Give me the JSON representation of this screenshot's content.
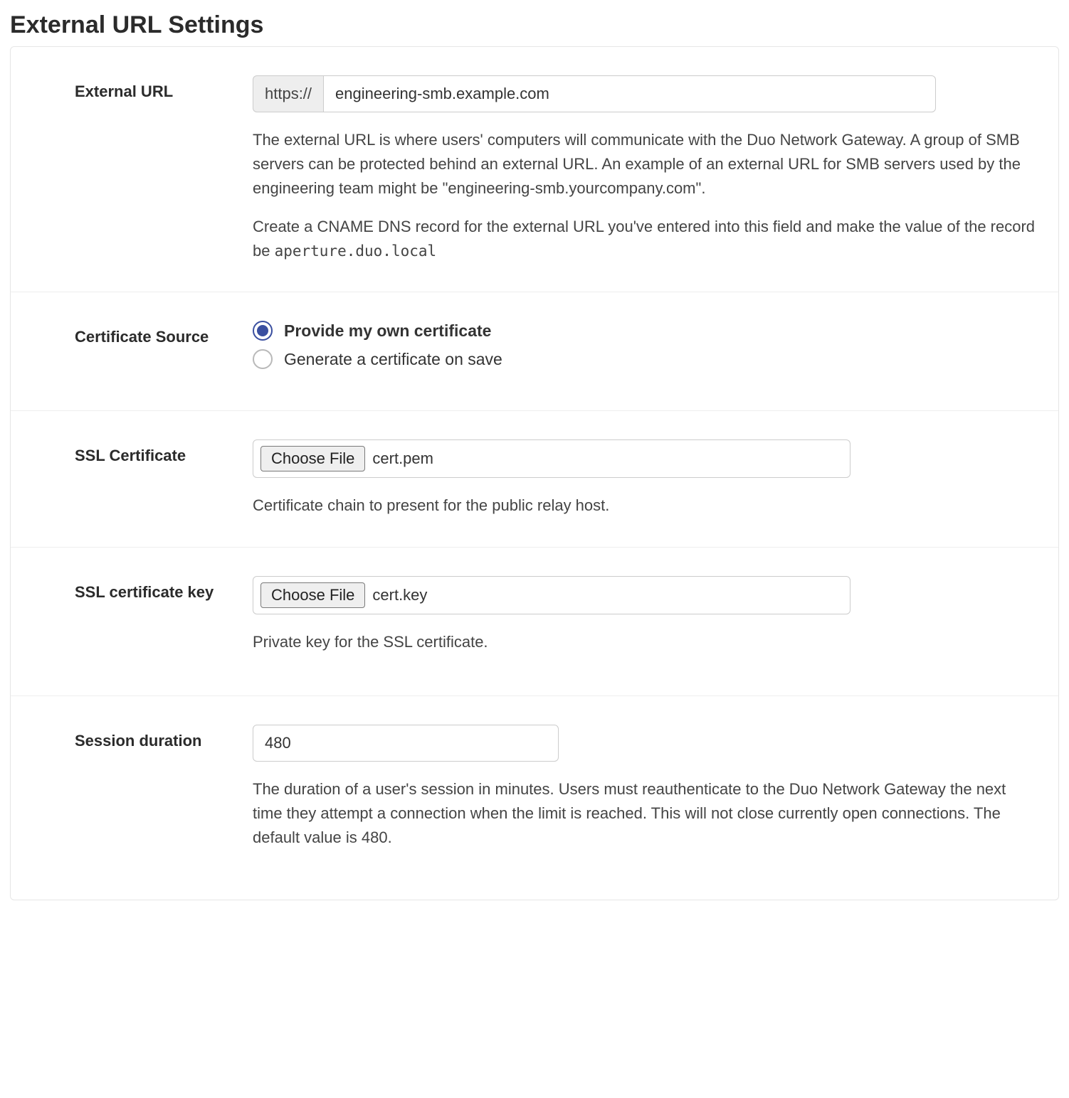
{
  "title": "External URL Settings",
  "external_url": {
    "label": "External URL",
    "prefix": "https://",
    "value": "engineering-smb.example.com",
    "help1": "The external URL is where users' computers will communicate with the Duo Network Gateway. A group of SMB servers can be protected behind an external URL. An example of an external URL for SMB servers used by the engineering team might be \"engineering-smb.yourcompany.com\".",
    "help2_prefix": "Create a CNAME DNS record for the external URL you've entered into this field and make the value of the record be ",
    "help2_code": "aperture.duo.local"
  },
  "cert_source": {
    "label": "Certificate Source",
    "options": {
      "own": "Provide my own certificate",
      "generate": "Generate a certificate on save"
    },
    "selected": "own"
  },
  "ssl_cert": {
    "label": "SSL Certificate",
    "button": "Choose File",
    "file": "cert.pem",
    "help": "Certificate chain to present for the public relay host."
  },
  "ssl_key": {
    "label": "SSL certificate key",
    "button": "Choose File",
    "file": "cert.key",
    "help": "Private key for the SSL certificate."
  },
  "session": {
    "label": "Session duration",
    "value": "480",
    "help": "The duration of a user's session in minutes. Users must reauthenticate to the Duo Network Gateway the next time they attempt a connection when the limit is reached. This will not close currently open connections. The default value is 480."
  }
}
